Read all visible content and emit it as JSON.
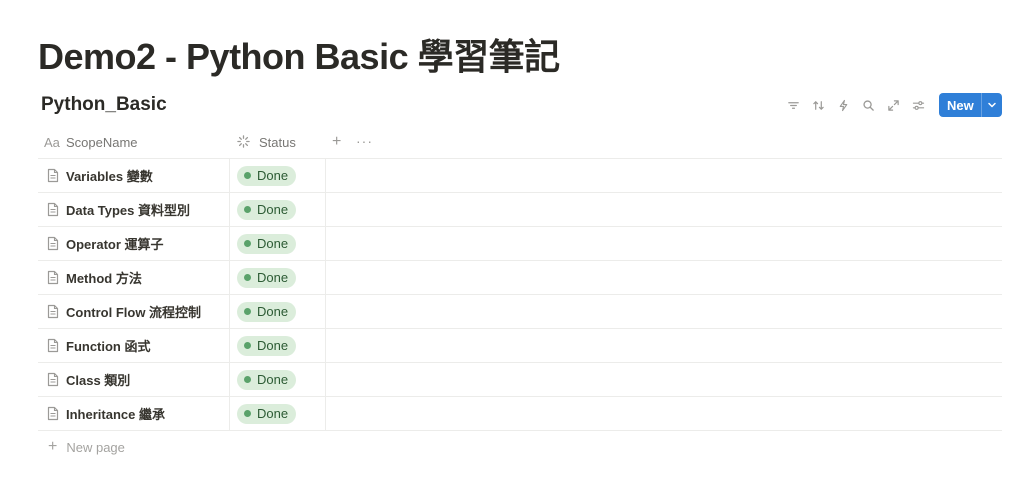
{
  "page": {
    "title": "Demo2 - Python Basic 學習筆記"
  },
  "database": {
    "title": "Python_Basic",
    "toolbar": {
      "icons": [
        "filter-icon",
        "sort-icon",
        "lightning-icon",
        "search-icon",
        "expand-icon",
        "settings-sliders-icon"
      ],
      "new_label": "New"
    },
    "columns": [
      {
        "icon": "text-aa-icon",
        "glyph": "Aa",
        "label": "ScopeName"
      },
      {
        "icon": "status-icon",
        "label": "Status"
      }
    ],
    "header_add": "+",
    "header_more": "···",
    "rows": [
      {
        "name": "Variables 變數",
        "status": "Done"
      },
      {
        "name": "Data Types 資料型別",
        "status": "Done"
      },
      {
        "name": "Operator 運算子",
        "status": "Done"
      },
      {
        "name": "Method 方法",
        "status": "Done"
      },
      {
        "name": "Control Flow 流程控制",
        "status": "Done"
      },
      {
        "name": "Function 函式",
        "status": "Done"
      },
      {
        "name": "Class 類別",
        "status": "Done"
      },
      {
        "name": "Inheritance 繼承",
        "status": "Done"
      }
    ],
    "new_page_label": "New page",
    "colors": {
      "accent": "#2f7fd8",
      "done_bg": "#dbeddb",
      "done_dot": "#5aa26a",
      "done_text": "#2c5b34"
    }
  }
}
